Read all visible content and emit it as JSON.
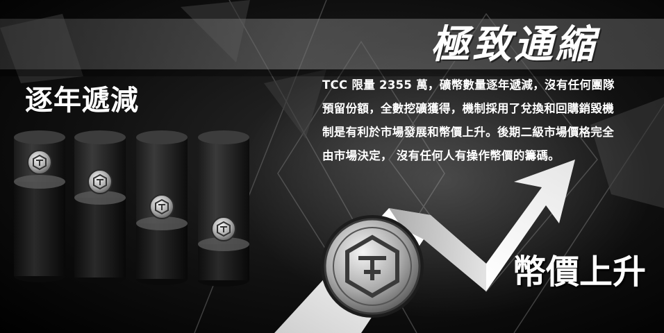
{
  "title": "極致通縮",
  "left_heading": "逐年遞減",
  "right_heading": "幣價上升",
  "description_lines": [
    "TCC 限量 2355 萬，礦幣數量逐年遞減，沒有任何團隊",
    "預留份額，全數挖礦獲得，機制採用了兌換和回購銷毀機",
    "制是有利於市場發展和幣價上升。後期二級市場價格完全",
    "由市場決定， 沒有任何人有操作幣價的籌碼。"
  ],
  "columns": [
    {
      "coin_level": 0.45
    },
    {
      "coin_level": 0.38
    },
    {
      "coin_level": 0.22
    },
    {
      "coin_level": 0.14
    }
  ],
  "colors": {
    "text": "#ffffff",
    "background": "#000000",
    "banner": "#808080"
  },
  "icons": [
    "coin-logo-icon",
    "rising-arrow-icon"
  ]
}
